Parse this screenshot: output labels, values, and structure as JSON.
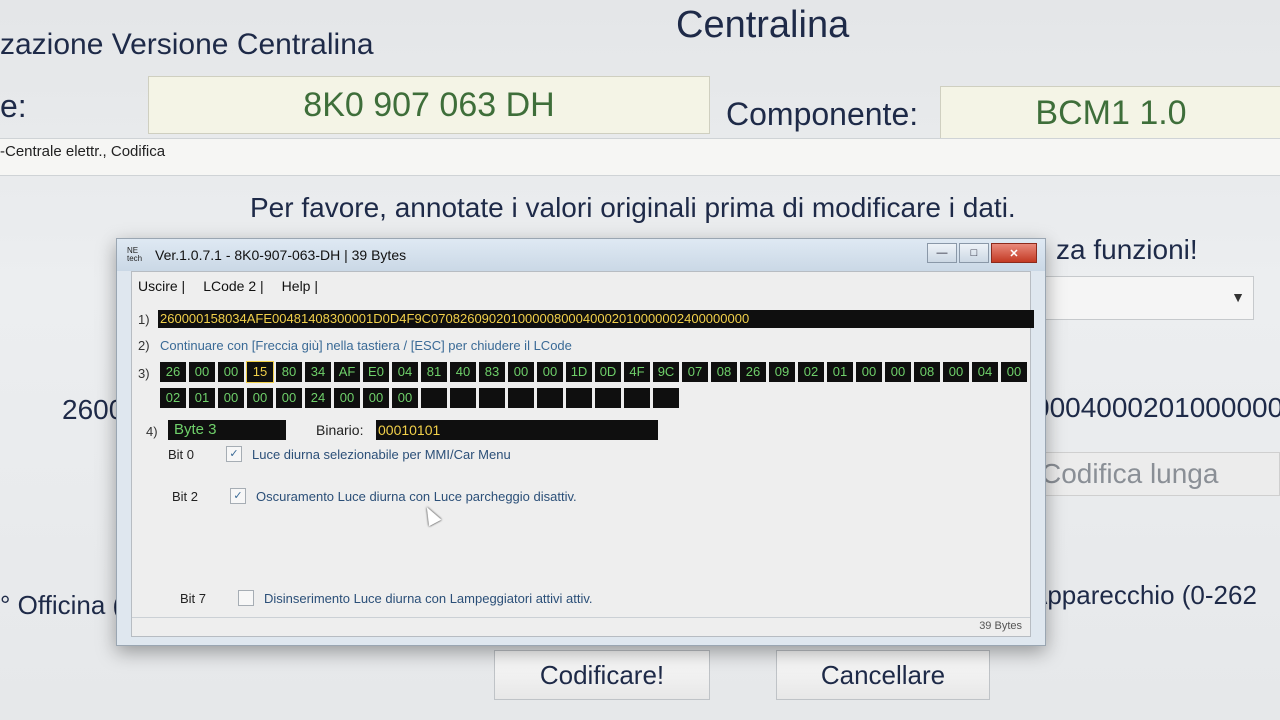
{
  "background": {
    "title": "Centralina",
    "heading": "zazione Versione Centralina",
    "codice_label": "e:",
    "codice_value": "8K0 907 063 DH",
    "componente_label": "Componente:",
    "componente_value": "BCM1 1.0",
    "strip_text": "-Centrale elettr.,  Codifica",
    "message_line1": "Per favore, annotate i valori originali prima di modificare i dati.",
    "message_line2_tail": "za funzioni!",
    "left_code_fragment": "2600",
    "right_code_fragment": "0004000201000000",
    "codifica_lunga_label": "Codifica lunga",
    "officina_label": "° Officina (",
    "apparecchio_label": "Apparecchio (0-262",
    "codificare_button": "Codificare!",
    "cancellare_button": "Cancellare"
  },
  "dialog": {
    "title": "Ver.1.0.7.1 -   8K0-907-063-DH | 39 Bytes",
    "icon_text": "NE\ntech",
    "menu": {
      "uscire": "Uscire |",
      "lcode2": "LCode 2 |",
      "help": "Help |"
    },
    "step_numbers": [
      "1)",
      "2)",
      "3)",
      "4)"
    ],
    "lcode": "260000158034AFE00481408300001D0D4F9C07082609020100000800040002010000002400000000",
    "step2_text": "Continuare con [Freccia giù] nella tastiera / [ESC] per chiudere il LCode",
    "bytes_row1": [
      "26",
      "00",
      "00",
      "15",
      "80",
      "34",
      "AF",
      "E0",
      "04",
      "81",
      "40",
      "83",
      "00",
      "00",
      "1D",
      "0D",
      "4F",
      "9C",
      "07",
      "08",
      "26",
      "09",
      "02",
      "01",
      "00",
      "00",
      "08",
      "00",
      "04",
      "00"
    ],
    "bytes_row2": [
      "02",
      "01",
      "00",
      "00",
      "00",
      "24",
      "00",
      "00",
      "00",
      "",
      "",
      "",
      "",
      "",
      "",
      "",
      "",
      ""
    ],
    "selected_byte_index": 3,
    "byte_label": "Byte 3",
    "binario_label": "Binario:",
    "binario_value": "00010101",
    "bits": [
      {
        "id": "Bit 0",
        "checked": true,
        "desc": "Luce diurna selezionabile per MMI/Car Menu"
      },
      {
        "id": "Bit 2",
        "checked": true,
        "desc": "Oscuramento Luce diurna con Luce parcheggio disattiv."
      },
      {
        "id": "Bit 7",
        "checked": false,
        "desc": "Disinserimento Luce diurna con Lampeggiatori attivi attiv."
      }
    ],
    "check_mark": "✓",
    "status": "39 Bytes",
    "window_buttons": {
      "minimize": "—",
      "maximize": "□",
      "close": "✕"
    }
  },
  "colors": {
    "hex_green": "#6fd06a",
    "hex_yellow": "#f1d04a",
    "field_green_text": "#3e6e3a",
    "close_red": "#c33a24"
  }
}
